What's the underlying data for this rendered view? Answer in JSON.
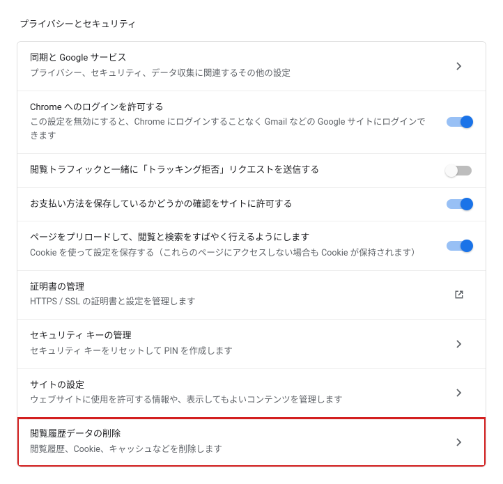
{
  "section": {
    "title": "プライバシーとセキュリティ"
  },
  "rows": {
    "sync": {
      "title": "同期と Google サービス",
      "desc": "プライバシー、セキュリティ、データ収集に関連するその他の設定"
    },
    "signin": {
      "title": "Chrome へのログインを許可する",
      "desc": "この設定を無効にすると、Chrome にログインすることなく Gmail などの Google サイトにログインできます",
      "toggle": true
    },
    "dnt": {
      "title": "閲覧トラフィックと一緒に「トラッキング拒否」リクエストを送信する",
      "toggle": false
    },
    "payments": {
      "title": "お支払い方法を保存しているかどうかの確認をサイトに許可する",
      "toggle": true
    },
    "preload": {
      "title": "ページをプリロードして、閲覧と検索をすばやく行えるようにします",
      "desc": "Cookie を使って設定を保存する（これらのページにアクセスしない場合も Cookie が保持されます）",
      "toggle": true
    },
    "certs": {
      "title": "証明書の管理",
      "desc": "HTTPS / SSL の証明書と設定を管理します"
    },
    "seckey": {
      "title": "セキュリティ キーの管理",
      "desc": "セキュリティ キーをリセットして PIN を作成します"
    },
    "site": {
      "title": "サイトの設定",
      "desc": "ウェブサイトに使用を許可する情報や、表示してもよいコンテンツを管理します"
    },
    "clear": {
      "title": "閲覧履歴データの削除",
      "desc": "閲覧履歴、Cookie、キャッシュなどを削除します"
    }
  }
}
